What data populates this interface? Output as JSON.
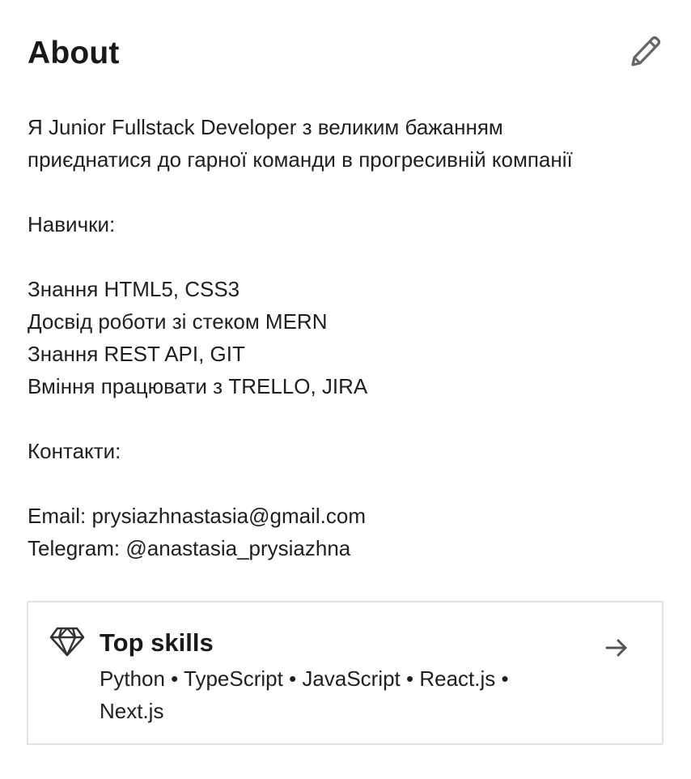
{
  "section": {
    "title": "About"
  },
  "about": {
    "lines": [
      "Я Junior Fullstack Developer з великим бажанням",
      "приєднатися до гарної команди в прогресивній компанії",
      "",
      "Навички:",
      "",
      "Знання HTML5, CSS3",
      "Досвід роботи зі стеком MERN",
      "Знання REST API, GIT",
      "Вміння працювати з TRELLO, JIRA",
      "",
      "Контакти:",
      "",
      "Email: prysiazhnastasia@gmail.com",
      "Telegram: @anastasia_prysiazhna"
    ]
  },
  "top_skills": {
    "title": "Top skills",
    "line1": "Python • TypeScript • JavaScript • React.js •",
    "line2": "Next.js"
  },
  "icons": {
    "edit": "pencil-icon",
    "skills": "diamond-icon",
    "open": "arrow-right-icon"
  },
  "colors": {
    "text": "#1f1f1f",
    "icon": "#666666",
    "border": "#e3e3e3"
  }
}
